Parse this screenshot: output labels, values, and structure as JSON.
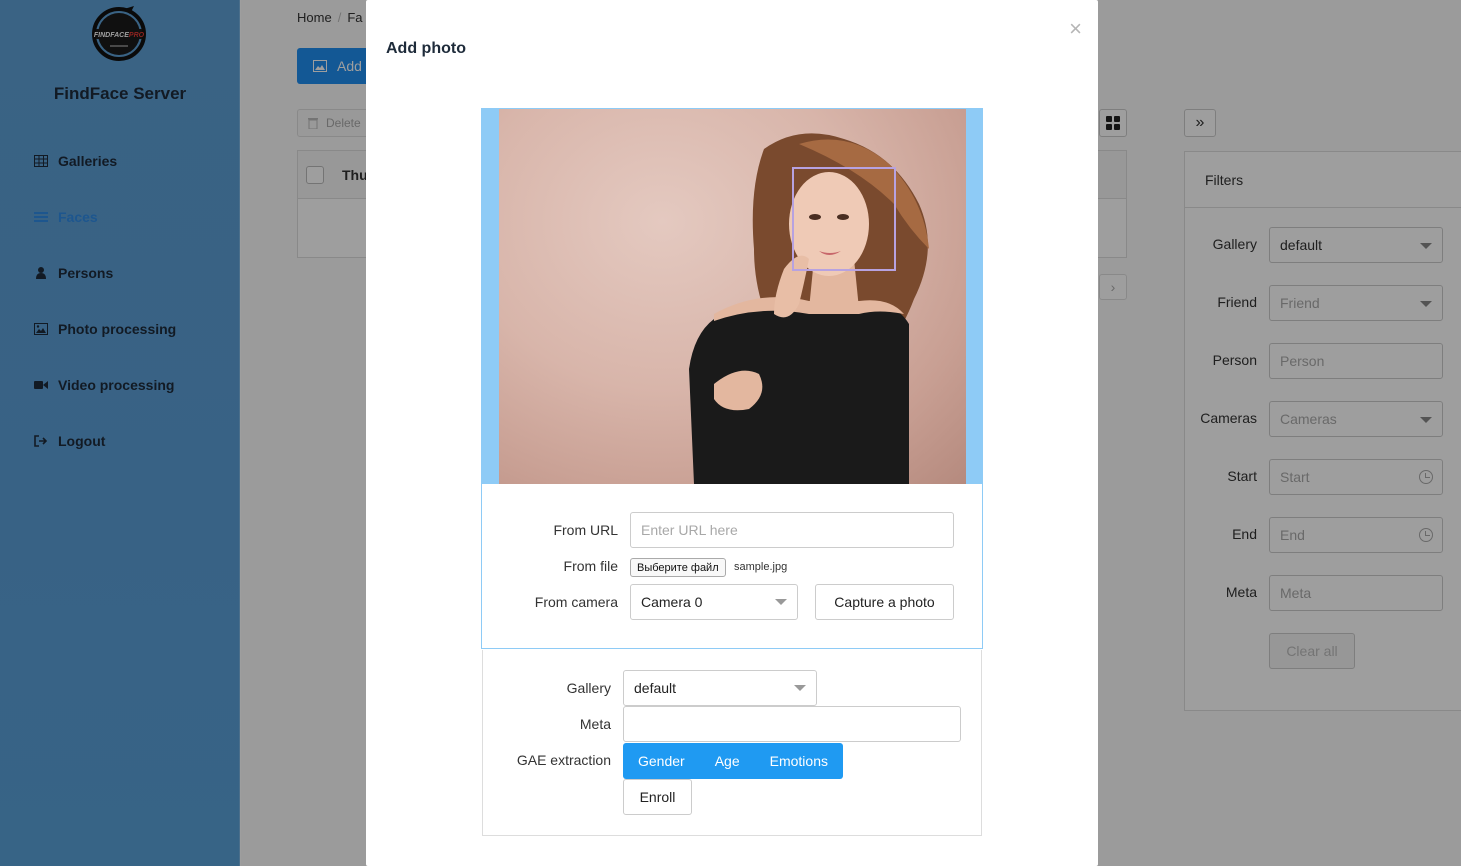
{
  "app": {
    "brand": "FindFace Server",
    "logo_text": "FINDFACEPRO"
  },
  "sidebar": {
    "items": [
      {
        "label": "Galleries",
        "icon": "table-icon",
        "active": false
      },
      {
        "label": "Faces",
        "icon": "list-icon",
        "active": true
      },
      {
        "label": "Persons",
        "icon": "user-icon",
        "active": false
      },
      {
        "label": "Photo processing",
        "icon": "image-icon",
        "active": false
      },
      {
        "label": "Video processing",
        "icon": "video-camera-icon",
        "active": false
      },
      {
        "label": "Logout",
        "icon": "sign-out-icon",
        "active": false
      }
    ]
  },
  "background": {
    "breadcrumb": {
      "home": "Home",
      "current": "Fa"
    },
    "add_button": "Add",
    "delete_button": "Delete",
    "table_header": "Thu",
    "filters": {
      "title": "Filters",
      "fields": [
        {
          "label": "Gallery",
          "value": "default",
          "placeholder": "",
          "kind": "select"
        },
        {
          "label": "Friend",
          "value": "",
          "placeholder": "Friend",
          "kind": "select"
        },
        {
          "label": "Person",
          "value": "",
          "placeholder": "Person",
          "kind": "text"
        },
        {
          "label": "Cameras",
          "value": "",
          "placeholder": "Cameras",
          "kind": "select"
        },
        {
          "label": "Start",
          "value": "",
          "placeholder": "Start",
          "kind": "date"
        },
        {
          "label": "End",
          "value": "",
          "placeholder": "End",
          "kind": "date"
        },
        {
          "label": "Meta",
          "value": "",
          "placeholder": "Meta",
          "kind": "text"
        }
      ],
      "clear_button": "Clear all"
    }
  },
  "modal": {
    "title": "Add photo",
    "close_glyph": "×",
    "upload": {
      "from_url_label": "From URL",
      "url_placeholder": "Enter URL here",
      "from_file_label": "From file",
      "file_button": "Выберите файл",
      "file_name": "sample.jpg",
      "from_camera_label": "From camera",
      "camera_selected": "Camera 0",
      "capture_button": "Capture a photo"
    },
    "enroll_form": {
      "gallery_label": "Gallery",
      "gallery_value": "default",
      "meta_label": "Meta",
      "meta_value": "",
      "gae_label": "GAE extraction",
      "gae_options": [
        "Gender",
        "Age",
        "Emotions"
      ],
      "enroll_button": "Enroll"
    }
  },
  "colors": {
    "accent": "#1f9af2",
    "sidebar_bg": "#5ea0d6",
    "photo_frame": "#8ecbf6",
    "face_box": "#b7a2e0"
  }
}
